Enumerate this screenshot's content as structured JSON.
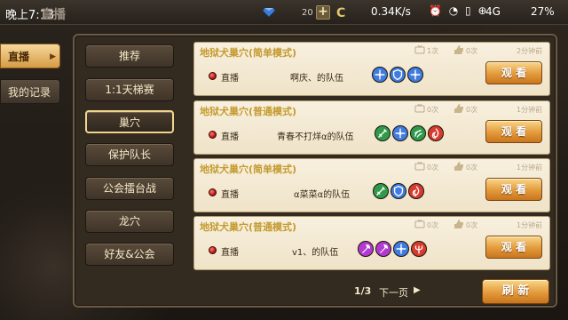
{
  "status_bar": {
    "time": "晚上7:13",
    "title": "直播",
    "currency": "20",
    "plus": "+",
    "coin": "C",
    "net_speed": "0.34K/s",
    "icons": "⏰ ◔ ▯ ⊕",
    "net_type": "4G",
    "battery": "27%"
  },
  "side_tabs": [
    {
      "label": "直播",
      "active": true
    },
    {
      "label": "我的记录",
      "active": false
    }
  ],
  "categories": [
    {
      "label": "推荐"
    },
    {
      "label": "1:1天梯赛"
    },
    {
      "label": "巢穴",
      "selected": true
    },
    {
      "label": "保护队长"
    },
    {
      "label": "公会擂台战"
    },
    {
      "label": "龙穴"
    },
    {
      "label": "好友&公会"
    }
  ],
  "rooms": [
    {
      "title": "地狱犬巢穴(简单模式)",
      "viewers": "1次",
      "likes": "0次",
      "time_ago": "2分钟前",
      "status": "直播",
      "team": "啊庆、的队伍",
      "watch": "观 看",
      "heroes": [
        {
          "icon": "spread-icon",
          "color": "#3f7be0"
        },
        {
          "icon": "shield-icon",
          "color": "#3f7be0"
        },
        {
          "icon": "spread-icon",
          "color": "#3f7be0"
        }
      ]
    },
    {
      "title": "地狱犬巢穴(普通模式)",
      "viewers": "0次",
      "likes": "0次",
      "time_ago": "1分钟前",
      "status": "直播",
      "team": "青春不打烊α的队伍",
      "watch": "观 看",
      "heroes": [
        {
          "icon": "sword-icon",
          "color": "#2e9a4a"
        },
        {
          "icon": "spread-icon",
          "color": "#3f7be0"
        },
        {
          "icon": "claw-icon",
          "color": "#2e9a4a"
        },
        {
          "icon": "flame-icon",
          "color": "#d83a2e"
        }
      ]
    },
    {
      "title": "地狱犬巢穴(简单模式)",
      "viewers": "0次",
      "likes": "0次",
      "time_ago": "1分钟前",
      "status": "直播",
      "team": "α菜菜α的队伍",
      "watch": "观 看",
      "heroes": [
        {
          "icon": "sword-icon",
          "color": "#2e9a4a"
        },
        {
          "icon": "shield-icon",
          "color": "#3f7be0"
        },
        {
          "icon": "flame-icon",
          "color": "#d83a2e"
        }
      ]
    },
    {
      "title": "地狱犬巢穴(普通模式)",
      "viewers": "0次",
      "likes": "0次",
      "time_ago": "1分钟前",
      "status": "直播",
      "team": "v1、的队伍",
      "watch": "观 看",
      "heroes": [
        {
          "icon": "axe-icon",
          "color": "#b23ad0"
        },
        {
          "icon": "axe-icon",
          "color": "#b23ad0"
        },
        {
          "icon": "spread-icon",
          "color": "#3f7be0"
        },
        {
          "icon": "trident-icon",
          "color": "#d83a2e"
        }
      ]
    }
  ],
  "pager": {
    "current": "1/3",
    "next_label": "下一页",
    "next_arrow": "▶"
  },
  "refresh_label": "刷 新"
}
